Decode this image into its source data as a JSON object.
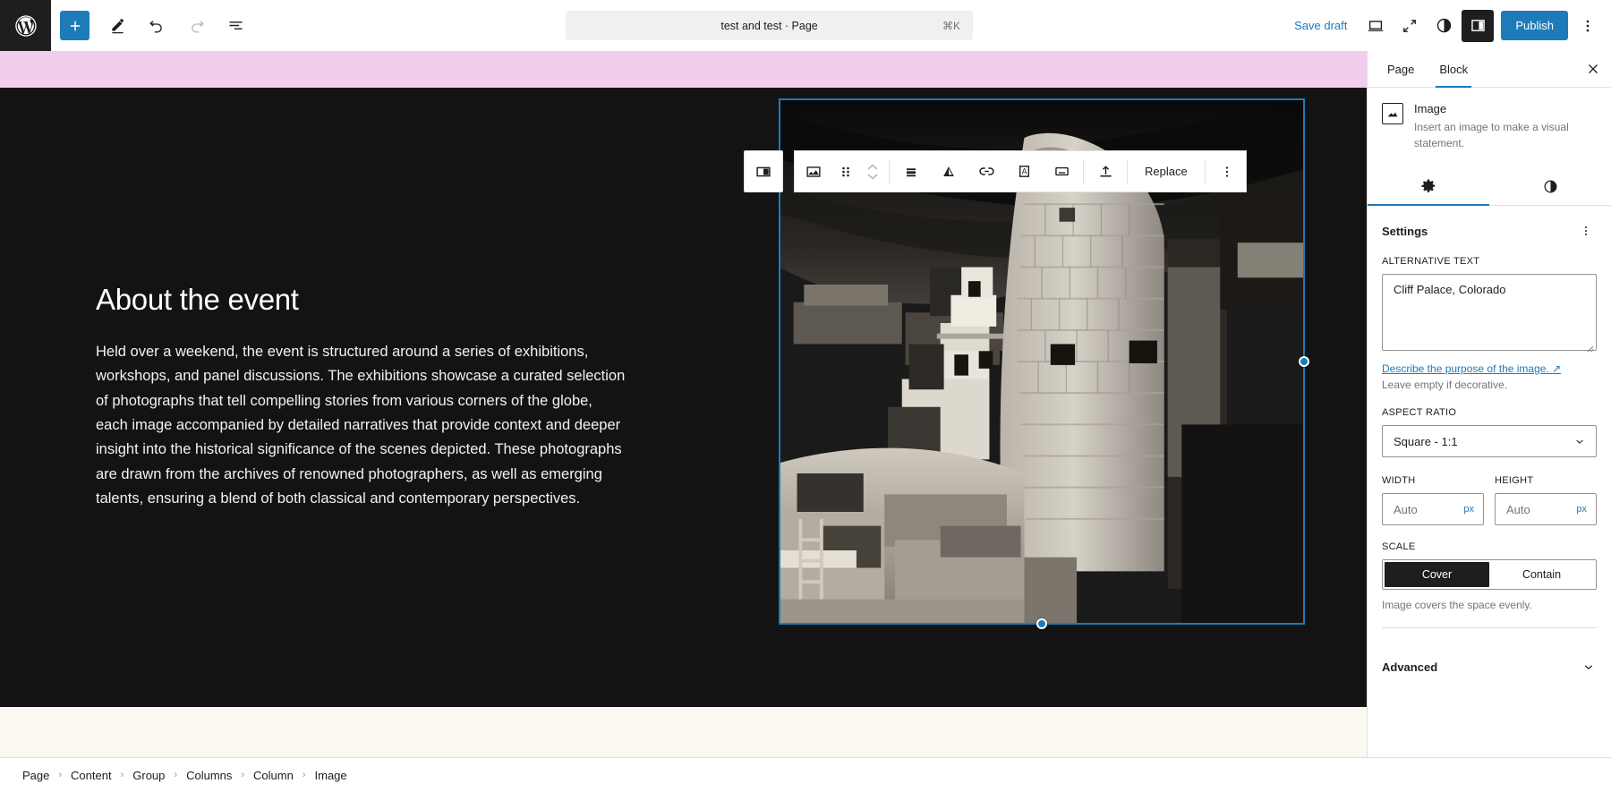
{
  "header": {
    "logo_label": "WordPress",
    "add_block_label": "+",
    "tools": [
      {
        "name": "add-block-button",
        "label": "Add block"
      },
      {
        "name": "edit-tool-button",
        "label": "Tools"
      },
      {
        "name": "undo-button",
        "label": "Undo"
      },
      {
        "name": "redo-button",
        "label": "Redo"
      },
      {
        "name": "document-overview-button",
        "label": "Document Overview"
      }
    ],
    "document_title": "test and test · Page",
    "command_shortcut": "⌘K",
    "save_draft_label": "Save draft",
    "publish_label": "Publish",
    "right_tools": [
      {
        "name": "view-device-button",
        "label": "View"
      },
      {
        "name": "zoom-out-button",
        "label": "Zoom out"
      },
      {
        "name": "styles-contrast-button",
        "label": "Styles"
      },
      {
        "name": "settings-sidebar-toggle",
        "label": "Settings"
      },
      {
        "name": "options-menu-button",
        "label": "Options"
      }
    ]
  },
  "block_toolbar": {
    "buttons": [
      {
        "name": "block-type-toggle",
        "label": "Image"
      },
      {
        "name": "image-block-icon-button",
        "label": "Image"
      },
      {
        "name": "drag-handle-button",
        "label": "Drag"
      },
      {
        "name": "move-updown-button",
        "label": "Move up or down"
      },
      {
        "name": "align-button",
        "label": "Align"
      },
      {
        "name": "filter-duotone-button",
        "label": "Apply duotone filter"
      },
      {
        "name": "link-button",
        "label": "Link"
      },
      {
        "name": "add-text-over-image-button",
        "label": "Add text over image"
      },
      {
        "name": "caption-button",
        "label": "Add caption"
      },
      {
        "name": "upload-button",
        "label": "Upload"
      }
    ],
    "replace_label": "Replace",
    "more_options_label": "Options"
  },
  "canvas": {
    "heading": "About the event",
    "paragraph": "Held over a weekend, the event is structured around a series of exhibitions, workshops, and panel discussions. The exhibitions showcase a curated selection of photographs that tell compelling stories from various corners of the globe, each image accompanied by detailed narratives that provide context and deeper insight into the historical significance of the scenes depicted. These photographs are drawn from the archives of renowned photographers, as well as emerging talents, ensuring a blend of both classical and contemporary perspectives.",
    "image_alt": "Cliff Palace, Colorado",
    "colors": {
      "band": "#f3cdee",
      "background": "#131313",
      "footer": "#fbf9f2",
      "selection": "#1e7bb9"
    }
  },
  "breadcrumb": {
    "separator": "›",
    "items": [
      "Page",
      "Content",
      "Group",
      "Columns",
      "Column",
      "Image"
    ]
  },
  "sidebar": {
    "tabs": [
      {
        "label": "Page",
        "active": false
      },
      {
        "label": "Block",
        "active": true
      }
    ],
    "close_label": "Close Settings",
    "block": {
      "title": "Image",
      "description": "Insert an image to make a visual statement."
    },
    "subtabs": [
      {
        "name": "settings-subtab",
        "icon": "gear-icon",
        "active": true
      },
      {
        "name": "styles-subtab",
        "icon": "contrast-icon",
        "active": false
      }
    ],
    "settings": {
      "title": "Settings",
      "more_label": "Settings options",
      "alt_text": {
        "label": "ALTERNATIVE TEXT",
        "value": "Cliff Palace, Colorado",
        "help_link": "Describe the purpose of the image.",
        "help_note": "Leave empty if decorative."
      },
      "aspect_ratio": {
        "label": "ASPECT RATIO",
        "value": "Square - 1:1"
      },
      "width": {
        "label": "WIDTH",
        "placeholder": "Auto",
        "unit": "px"
      },
      "height": {
        "label": "HEIGHT",
        "placeholder": "Auto",
        "unit": "px"
      },
      "scale": {
        "label": "SCALE",
        "options": [
          "Cover",
          "Contain"
        ],
        "selected": "Cover",
        "note": "Image covers the space evenly."
      },
      "advanced_label": "Advanced"
    }
  }
}
